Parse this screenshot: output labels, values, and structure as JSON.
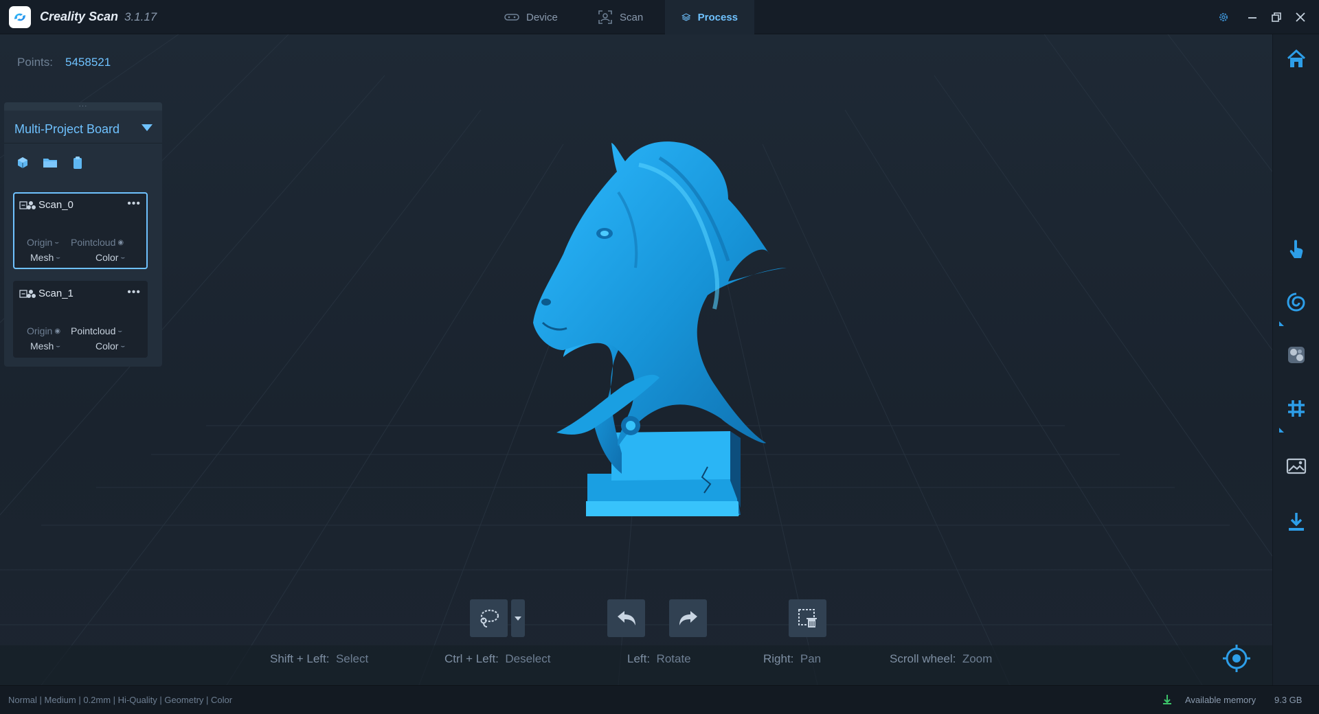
{
  "app": {
    "name": "Creality Scan",
    "version": "3.1.17"
  },
  "nav": {
    "tabs": [
      {
        "label": "Device",
        "icon": "device-icon",
        "active": false
      },
      {
        "label": "Scan",
        "icon": "scan-icon",
        "active": false
      },
      {
        "label": "Process",
        "icon": "layers-icon",
        "active": true
      }
    ]
  },
  "viewport": {
    "points_label": "Points:",
    "points_value": "5458521",
    "model_color": "#1aa6e8"
  },
  "board": {
    "title": "Multi-Project Board",
    "tools": [
      "cube-icon",
      "folder-icon",
      "clipboard-icon"
    ],
    "scans": [
      {
        "name": "Scan_0",
        "selected": true,
        "origin": "Origin",
        "pointcloud": "Pointcloud",
        "mesh": "Mesh",
        "color": "Color"
      },
      {
        "name": "Scan_1",
        "selected": false,
        "origin": "Origin",
        "pointcloud": "Pointcloud",
        "mesh": "Mesh",
        "color": "Color"
      }
    ],
    "more_label": "•••"
  },
  "hints": [
    {
      "key": "Shift + Left:",
      "action": "Select"
    },
    {
      "key": "Ctrl + Left:",
      "action": "Deselect"
    },
    {
      "key": "Left:",
      "action": "Rotate"
    },
    {
      "key": "Right:",
      "action": "Pan"
    },
    {
      "key": "Scroll wheel:",
      "action": "Zoom"
    }
  ],
  "status": {
    "left": "Normal | Medium | 0.2mm | Hi-Quality | Geometry | Color",
    "memory_label": "Available memory",
    "memory_value": "9.3 GB"
  },
  "colors": {
    "accent": "#6fc2ff",
    "sidebar_icon": "#2d9ee8",
    "background": "#1b2430"
  }
}
